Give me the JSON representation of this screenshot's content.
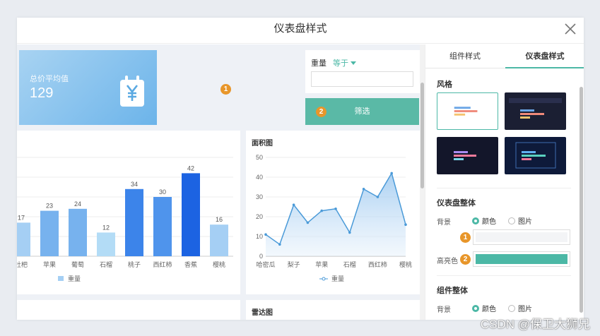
{
  "modal": {
    "title": "仪表盘样式"
  },
  "kpi": {
    "label": "总价平均值",
    "value": "129"
  },
  "markers": {
    "one": "1",
    "two": "2"
  },
  "filter": {
    "label": "重量",
    "operator": "等于",
    "button_label": "筛选"
  },
  "area_card": {
    "title": "面积图"
  },
  "radar_card": {
    "title": "雷达图"
  },
  "panel": {
    "tabs": [
      "组件样式",
      "仪表盘样式"
    ],
    "style_title": "风格",
    "dashboard_section": "仪表盘整体",
    "component_section": "组件整体",
    "bg_label": "背景",
    "highlight_label": "高亮色",
    "opt_color": "颜色",
    "opt_image": "图片"
  },
  "colors": {
    "accent": "#4cb8a6",
    "marker": "#e8962a",
    "highlight": "#4cb8a6"
  },
  "watermark": "CSDN @保卫大狮兄",
  "chart_data": [
    {
      "type": "bar",
      "categories": [
        "枇杷",
        "苹果",
        "葡萄",
        "石榴",
        "桃子",
        "西红柿",
        "香蕉",
        "樱桃"
      ],
      "category_labels": [
        "杜杷",
        "苹果",
        "葡萄",
        "石榴",
        "桃子",
        "西红柿",
        "香蕉",
        "樱桃"
      ],
      "values": [
        17,
        23,
        24,
        12,
        34,
        30,
        42,
        16
      ],
      "series": [
        {
          "name": "重量",
          "values": [
            17,
            23,
            24,
            12,
            34,
            30,
            42,
            16
          ]
        }
      ],
      "ylim": [
        0,
        50
      ],
      "grid": true,
      "legend": "bottom"
    },
    {
      "type": "area",
      "title": "面积图",
      "x": [
        "哈密瓜",
        "",
        "梨子",
        "",
        "苹果",
        "",
        "石榴",
        "",
        "西红柿",
        "",
        "樱桃"
      ],
      "tick_labels": [
        "哈密瓜",
        "梨子",
        "苹果",
        "石榴",
        "西红柿",
        "樱桃"
      ],
      "values": [
        11,
        6,
        26,
        17,
        23,
        24,
        12,
        34,
        30,
        42,
        16
      ],
      "series": [
        {
          "name": "重量",
          "values": [
            11,
            6,
            26,
            17,
            23,
            24,
            12,
            34,
            30,
            42,
            16
          ]
        }
      ],
      "yticks": [
        "0",
        "10",
        "20",
        "30",
        "40",
        "50"
      ],
      "ylim": [
        0,
        50
      ],
      "grid": true,
      "legend": "bottom"
    }
  ]
}
